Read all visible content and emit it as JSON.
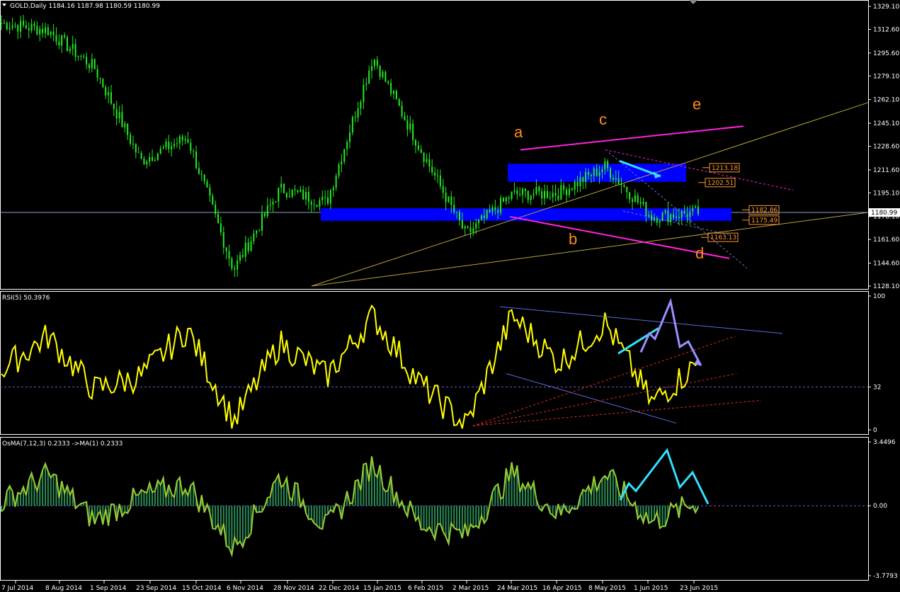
{
  "header": {
    "price_pane_title": "GOLD,Daily  1184.16 1187.98 1180.59 1180.99",
    "rsi_pane_title": "RSI(5) 50.3976",
    "osma_pane_title": "OsMA(7,12,3) 0.2333  ->MA(1) 0.2333"
  },
  "price_axis": {
    "ticks": [
      "1329.10",
      "1312.60",
      "1295.60",
      "1279.10",
      "1262.10",
      "1245.10",
      "1228.60",
      "1211.60",
      "1195.10",
      "1178.10",
      "1161.60",
      "1144.60",
      "1128.10"
    ],
    "current_price_label": "1180.99"
  },
  "price_levels": [
    "1213.18",
    "1202.51",
    "1182.86",
    "1175.49",
    "1163.13"
  ],
  "wave_labels": [
    "a",
    "b",
    "c",
    "d",
    "e"
  ],
  "rsi_axis": {
    "ticks": [
      "100",
      "32",
      "0"
    ]
  },
  "osma_axis": {
    "ticks": [
      "3.4496",
      "0.00",
      "-3.7793"
    ]
  },
  "time_axis": {
    "labels": [
      "7 Jul 2014",
      "8 Aug 2014",
      "1 Sep 2014",
      "23 Sep 2014",
      "15 Oct 2014",
      "6 Nov 2014",
      "28 Nov 2014",
      "22 Dec 2014",
      "15 Jan 2015",
      "6 Feb 2015",
      "2 Mar 2015",
      "24 Mar 2015",
      "16 Apr 2015",
      "8 May 2015",
      "1 Jun 2015",
      "23 Jun 2015"
    ]
  },
  "colors": {
    "background": "#000000",
    "candles": "#22ee22",
    "rsi_line": "#ffff00",
    "osma_line": "#9acd32",
    "osma_hist": "#2e8b57",
    "zone_blue": "#0000ff",
    "wave_label": "#ff8c1a",
    "wave_line": "#ff22dd",
    "trend_line": "#b8a040",
    "arrow_cyan": "#33e0ff",
    "arrow_violet": "#9a90ff",
    "level_label": "#ff9a30"
  },
  "chart_data": [
    {
      "type": "candlestick",
      "title": "GOLD,Daily",
      "ylim": [
        1128.1,
        1329.1
      ],
      "x": [
        "7 Jul 2014",
        "8 Aug 2014",
        "1 Sep 2014",
        "23 Sep 2014",
        "15 Oct 2014",
        "6 Nov 2014",
        "28 Nov 2014",
        "22 Dec 2014",
        "15 Jan 2015",
        "6 Feb 2015",
        "2 Mar 2015",
        "24 Mar 2015",
        "16 Apr 2015",
        "8 May 2015",
        "1 Jun 2015",
        "23 Jun 2015"
      ],
      "close": [
        1317,
        1312,
        1285,
        1218,
        1235,
        1140,
        1198,
        1188,
        1293,
        1228,
        1165,
        1194,
        1195,
        1214,
        1178,
        1181
      ],
      "last": {
        "open": 1184.16,
        "high": 1187.98,
        "low": 1180.59,
        "close": 1180.99
      },
      "levels": [
        1213.18,
        1202.51,
        1182.86,
        1175.49,
        1163.13
      ]
    },
    {
      "type": "line",
      "title": "RSI(5)",
      "ylim": [
        0,
        100
      ],
      "reference_level": 32,
      "last_value": 50.3976,
      "x": [
        "7 Jul 2014",
        "8 Aug 2014",
        "1 Sep 2014",
        "23 Sep 2014",
        "15 Oct 2014",
        "6 Nov 2014",
        "28 Nov 2014",
        "22 Dec 2014",
        "15 Jan 2015",
        "6 Feb 2015",
        "2 Mar 2015",
        "24 Mar 2015",
        "16 Apr 2015",
        "8 May 2015",
        "1 Jun 2015",
        "23 Jun 2015"
      ],
      "values": [
        45,
        70,
        30,
        40,
        75,
        6,
        65,
        40,
        85,
        35,
        3,
        85,
        50,
        80,
        20,
        50
      ]
    },
    {
      "type": "bar",
      "title": "OsMA(7,12,3)",
      "ylim": [
        -3.7793,
        3.4496
      ],
      "last_value": 0.2333,
      "x": [
        "7 Jul 2014",
        "8 Aug 2014",
        "1 Sep 2014",
        "23 Sep 2014",
        "15 Oct 2014",
        "6 Nov 2014",
        "28 Nov 2014",
        "22 Dec 2014",
        "15 Jan 2015",
        "6 Feb 2015",
        "2 Mar 2015",
        "24 Mar 2015",
        "16 Apr 2015",
        "8 May 2015",
        "1 Jun 2015",
        "23 Jun 2015"
      ],
      "values": [
        0.2,
        1.7,
        -0.8,
        0.5,
        1.2,
        -2.3,
        1.6,
        -1.2,
        2.3,
        -1.0,
        -1.6,
        1.8,
        -0.5,
        1.7,
        -0.9,
        0.23
      ]
    }
  ]
}
